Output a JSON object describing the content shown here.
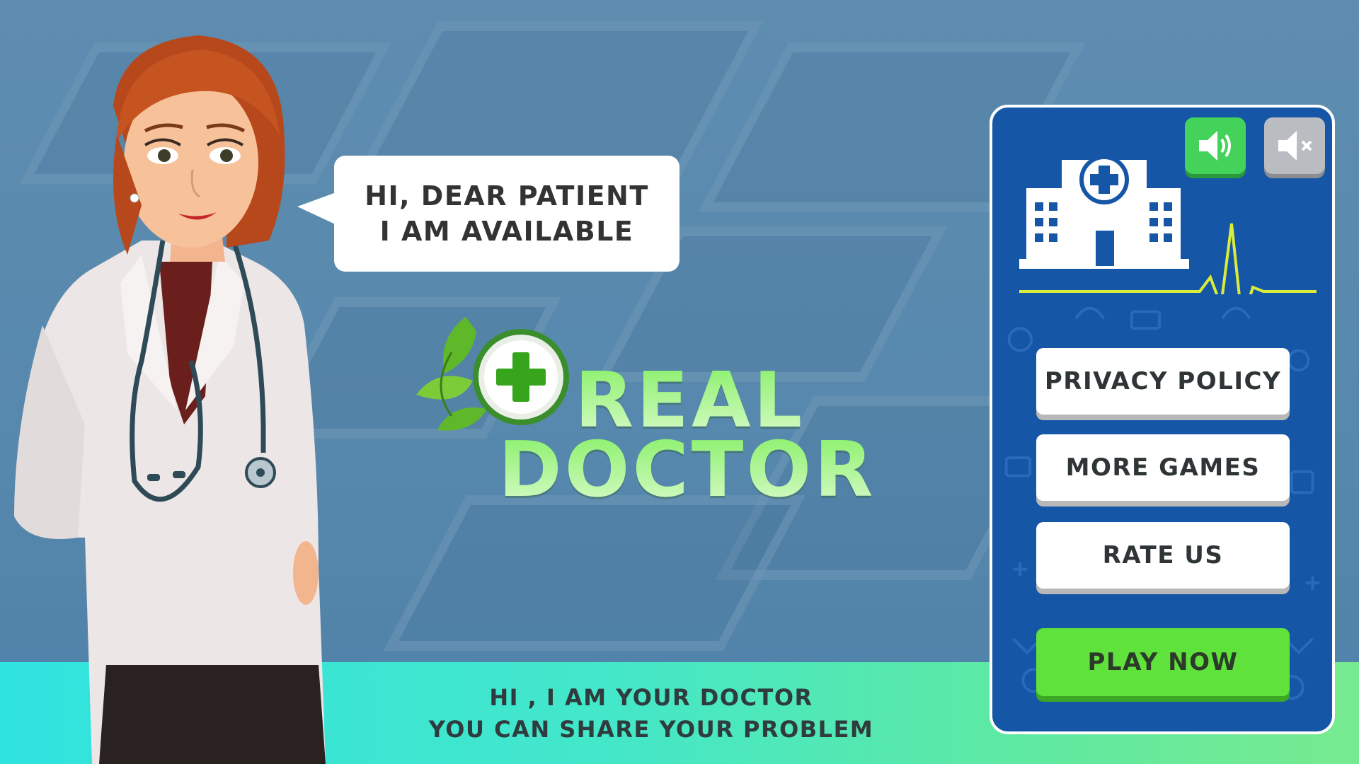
{
  "speech_bubble": {
    "line1": "HI, DEAR PATIENT",
    "line2": "I AM AVAILABLE"
  },
  "logo": {
    "word1": "REAL",
    "word2": "DOCTOR",
    "emblem_icon": "medical-cross-leaf-icon"
  },
  "banner": {
    "line1": "HI , I AM YOUR DOCTOR",
    "line2": "YOU CAN SHARE YOUR PROBLEM"
  },
  "panel": {
    "sound_on_icon": "speaker-on-icon",
    "sound_off_icon": "speaker-muted-icon",
    "hospital_icon": "hospital-heartbeat-icon",
    "buttons": {
      "privacy": "PRIVACY POLICY",
      "more_games": "MORE GAMES",
      "rate": "RATE US",
      "play": "PLAY NOW"
    }
  },
  "colors": {
    "panel_bg": "#1656a6",
    "play_button": "#5fe23c",
    "sound_on": "#44d35a",
    "sound_off": "#b9bcc0",
    "logo_green": "#8af06a",
    "banner_start": "#2fe3df",
    "banner_end": "#77ea8f"
  }
}
